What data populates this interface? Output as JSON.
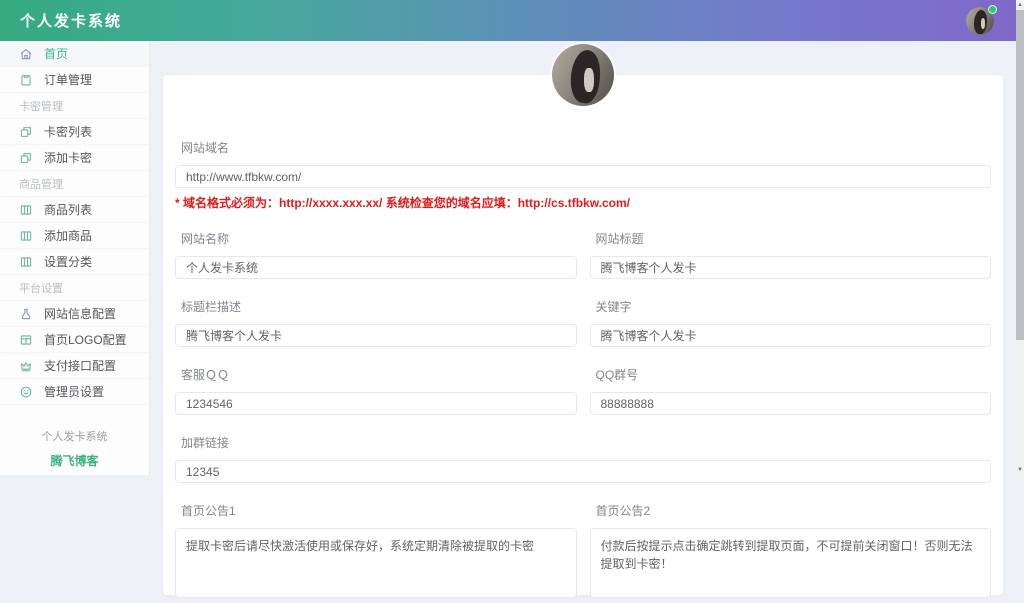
{
  "header": {
    "title": "个人发卡系统"
  },
  "colors": {
    "gradient_start": "#35ab80",
    "gradient_end": "#8068c9",
    "accent_green": "#3cb98c",
    "note_red": "#e11b1b",
    "online_badge": "#2ecc71"
  },
  "sidebar": {
    "items": [
      {
        "label": "首页"
      },
      {
        "label": "订单管理"
      },
      {
        "label": "卡密管理"
      },
      {
        "label": "卡密列表"
      },
      {
        "label": "添加卡密"
      },
      {
        "label": "商品管理"
      },
      {
        "label": "商品列表"
      },
      {
        "label": "添加商品"
      },
      {
        "label": "设置分类"
      },
      {
        "label": "平台设置"
      },
      {
        "label": "网站信息配置"
      },
      {
        "label": "首页LOGO配置"
      },
      {
        "label": "支付接口配置"
      },
      {
        "label": "管理员设置"
      }
    ],
    "footer": {
      "line1": "个人发卡系统",
      "line2": "腾飞博客"
    }
  },
  "form": {
    "domain": {
      "label": "网站域名",
      "value": "http://www.tfbkw.com/"
    },
    "domain_note": "* 域名格式必须为：http://xxxx.xxx.xx/ 系统检查您的域名应填：http://cs.tfbkw.com/",
    "site_name": {
      "label": "网站名称",
      "value": "个人发卡系统"
    },
    "site_title": {
      "label": "网站标题",
      "value": "腾飞博客个人发卡"
    },
    "title_desc": {
      "label": "标题栏描述",
      "value": "腾飞博客个人发卡"
    },
    "keywords": {
      "label": "关键字",
      "value": "腾飞博客个人发卡"
    },
    "service_qq": {
      "label": "客服ＱＱ",
      "value": "1234546"
    },
    "qq_group": {
      "label": "QQ群号",
      "value": "88888888"
    },
    "group_link": {
      "label": "加群链接",
      "value": "12345"
    },
    "notice1": {
      "label": "首页公告1",
      "value": "提取卡密后请尽快激活使用或保存好，系统定期清除被提取的卡密"
    },
    "notice2": {
      "label": "首页公告2",
      "value": "付款后按提示点击确定跳转到提取页面，不可提前关闭窗口！否则无法提取到卡密！"
    }
  }
}
